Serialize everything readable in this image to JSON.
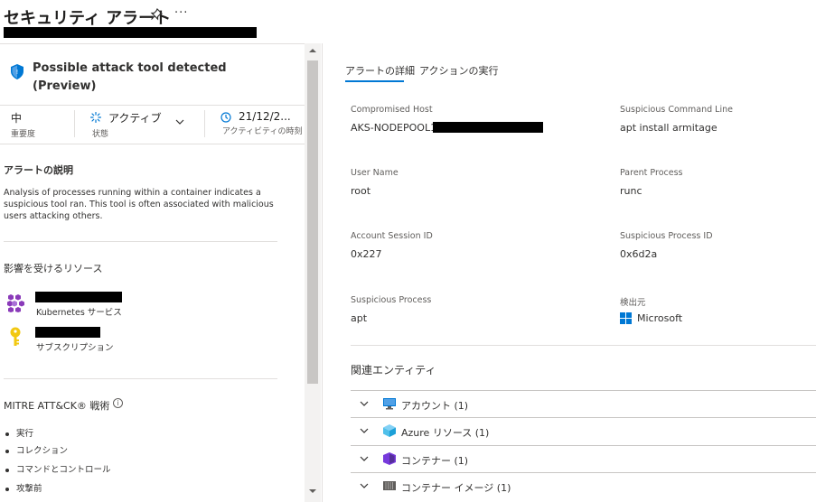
{
  "header": {
    "title": "セキュリティ アラート",
    "more_label": "···"
  },
  "alert": {
    "name": "Possible attack tool detected (Preview)",
    "severity_value": "中",
    "severity_label": "重要度",
    "status_value": "アクティブ",
    "status_label": "状態",
    "time_value": "21/12/2...",
    "time_label": "アクティビティの時刻"
  },
  "description": {
    "title": "アラートの説明",
    "text": "Analysis of processes running within a container indicates a suspicious tool ran. This tool is often associated with malicious users attacking others."
  },
  "resources": {
    "title": "影響を受けるリソース",
    "items": [
      {
        "type_label": "Kubernetes サービス",
        "icon": "kubernetes-icon"
      },
      {
        "type_label": "サブスクリプション",
        "icon": "key-icon"
      }
    ]
  },
  "mitre": {
    "title": "MITRE ATT&CK® 戦術",
    "info": "i",
    "tactics": [
      "実行",
      "コレクション",
      "コマンドとコントロール",
      "攻撃前"
    ]
  },
  "tabs": [
    "アラートの詳細",
    "アクションの実行"
  ],
  "details": {
    "compromised_host_label": "Compromised Host",
    "compromised_host_value": "AKS-NODEPOOL1-",
    "suspicious_cmd_label": "Suspicious Command Line",
    "suspicious_cmd_value": "apt install armitage",
    "user_name_label": "User Name",
    "user_name_value": "root",
    "parent_process_label": "Parent Process",
    "parent_process_value": "runc",
    "account_session_label": "Account Session ID",
    "account_session_value": "0x227",
    "suspicious_pid_label": "Suspicious Process ID",
    "suspicious_pid_value": "0x6d2a",
    "suspicious_process_label": "Suspicious Process",
    "suspicious_process_value": "apt",
    "detected_by_label": "検出元",
    "detected_by_value": "Microsoft"
  },
  "related": {
    "title": "関連エンティティ",
    "items": [
      {
        "label": "アカウント (1)",
        "icon": "monitor-icon"
      },
      {
        "label": "Azure リソース (1)",
        "icon": "cube-icon"
      },
      {
        "label": "コンテナー (1)",
        "icon": "container-icon"
      },
      {
        "label": "コンテナー イメージ (1)",
        "icon": "container-image-icon"
      }
    ]
  },
  "colors": {
    "accent": "#0078d4",
    "ms_red": "#f25022",
    "ms_green": "#7fba00",
    "ms_blue": "#00a4ef",
    "ms_yellow": "#ffb900"
  }
}
